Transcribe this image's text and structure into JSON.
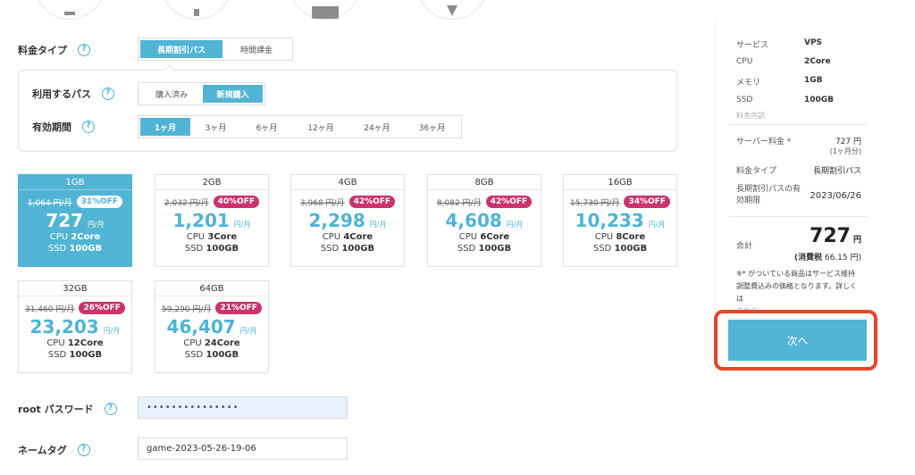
{
  "top_icons": [
    "server-icon",
    "tools-icon",
    "app-icon",
    "location-icon"
  ],
  "plan_type": {
    "label": "料金タイプ",
    "options": [
      "長期割引パス",
      "時間課金"
    ],
    "selected": "長期割引パス"
  },
  "pass_use": {
    "label": "利用するパス",
    "options": [
      "購入済み",
      "新規購入"
    ],
    "selected": "新規購入"
  },
  "validity": {
    "label": "有効期間",
    "options": [
      "1ヶ月",
      "3ヶ月",
      "6ヶ月",
      "12ヶ月",
      "24ヶ月",
      "36ヶ月"
    ],
    "selected": "1ヶ月"
  },
  "plans": [
    {
      "memory": "1GB",
      "original": "1,064 円/月",
      "discount": "31%OFF",
      "price": "727",
      "unit": "円/月",
      "cpu_label": "CPU",
      "cpu": "2Core",
      "ssd_label": "SSD",
      "ssd": "100GB",
      "selected": true
    },
    {
      "memory": "2GB",
      "original": "2,032 円/月",
      "discount": "40%OFF",
      "price": "1,201",
      "unit": "円/月",
      "cpu_label": "CPU",
      "cpu": "3Core",
      "ssd_label": "SSD",
      "ssd": "100GB",
      "selected": false
    },
    {
      "memory": "4GB",
      "original": "3,968 円/月",
      "discount": "42%OFF",
      "price": "2,298",
      "unit": "円/月",
      "cpu_label": "CPU",
      "cpu": "4Core",
      "ssd_label": "SSD",
      "ssd": "100GB",
      "selected": false
    },
    {
      "memory": "8GB",
      "original": "8,082 円/月",
      "discount": "42%OFF",
      "price": "4,608",
      "unit": "円/月",
      "cpu_label": "CPU",
      "cpu": "6Core",
      "ssd_label": "SSD",
      "ssd": "100GB",
      "selected": false
    },
    {
      "memory": "16GB",
      "original": "15,730 円/月",
      "discount": "34%OFF",
      "price": "10,233",
      "unit": "円/月",
      "cpu_label": "CPU",
      "cpu": "8Core",
      "ssd_label": "SSD",
      "ssd": "100GB",
      "selected": false
    },
    {
      "memory": "32GB",
      "original": "31,460 円/月",
      "discount": "26%OFF",
      "price": "23,203",
      "unit": "円/月",
      "cpu_label": "CPU",
      "cpu": "12Core",
      "ssd_label": "SSD",
      "ssd": "100GB",
      "selected": false
    },
    {
      "memory": "64GB",
      "original": "59,290 円/月",
      "discount": "21%OFF",
      "price": "46,407",
      "unit": "円/月",
      "cpu_label": "CPU",
      "cpu": "24Core",
      "ssd_label": "SSD",
      "ssd": "100GB",
      "selected": false
    }
  ],
  "root_password": {
    "label": "root パスワード",
    "value": "•••••••••••••••"
  },
  "name_tag": {
    "label": "ネームタグ",
    "value": "game-2023-05-26-19-06"
  },
  "summary": {
    "specs": [
      {
        "key": "サービス",
        "value": "VPS"
      },
      {
        "key": "CPU",
        "value": "2Core"
      },
      {
        "key": "メモリ",
        "value": "1GB"
      },
      {
        "key": "SSD",
        "value": "100GB"
      }
    ],
    "breakdown_title": "料金内訳",
    "server_fee_label": "サーバー料金 *",
    "server_fee_value": "727 円",
    "server_fee_period": "(1ヶ月分)",
    "plan_type_label": "料金タイプ",
    "plan_type_value": "長期割引パス",
    "expiry_label": "長期割引パスの有効期限",
    "expiry_value": "2023/06/26",
    "total_label": "合計",
    "total_value": "727",
    "total_currency": "円",
    "tax_label": "(消費税",
    "tax_value": "66.15 円)",
    "note": "※* がついている商品はサービス維持調整費込みの価格となります。詳しくは",
    "note_link": "こちら",
    "next_button": "次へ"
  },
  "colors": {
    "accent": "#52b4d4",
    "discount_badge": "#c9336e",
    "highlight_border": "#e9442b",
    "password_bg": "#e8f0fe"
  }
}
